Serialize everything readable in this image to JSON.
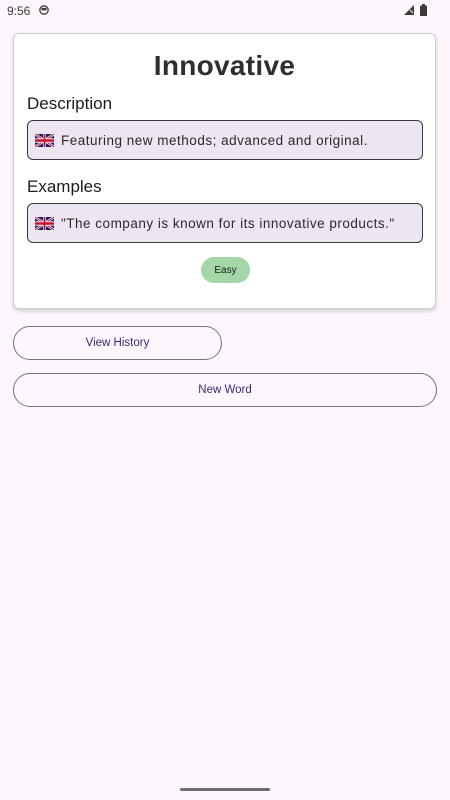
{
  "status_bar": {
    "time": "9:56"
  },
  "word_card": {
    "word": "Innovative",
    "description_heading": "Description",
    "description_text": "Featuring new methods; advanced and original.",
    "examples_heading": "Examples",
    "example_text": "\"The company is known for its innovative products.\"",
    "language_flag_icon": "uk-flag-icon",
    "difficulty": "Easy"
  },
  "actions": {
    "view_history_label": "View History",
    "new_word_label": "New Word"
  },
  "colors": {
    "background": "#fdf7fd",
    "card": "#ffffff",
    "text_box": "#ede5f2",
    "difficulty_easy": "#a3d7a8",
    "button_text": "#3a2870"
  }
}
